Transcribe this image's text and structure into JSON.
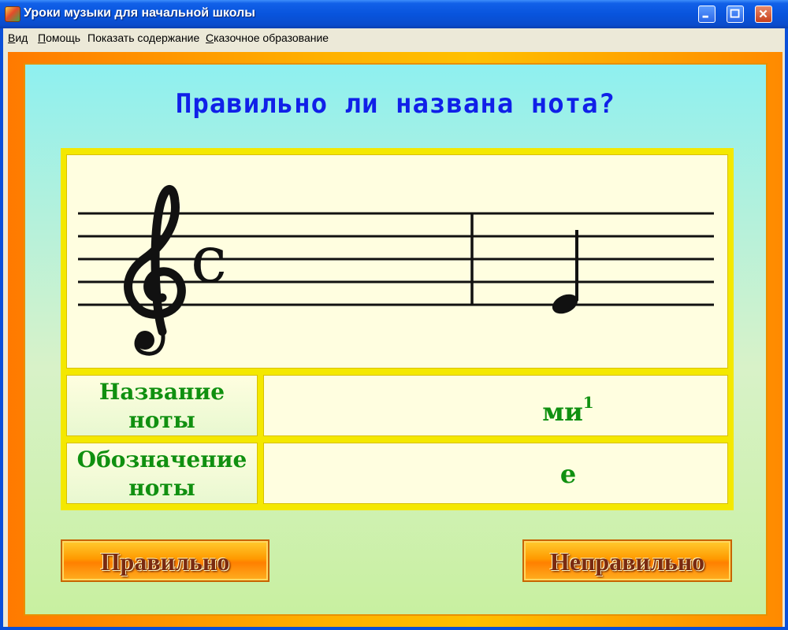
{
  "window": {
    "title": "Уроки музыки для начальной школы",
    "colors": {
      "titlebar": "#0854dd",
      "frame_orange": "#ff8a00"
    }
  },
  "menu": {
    "items": [
      {
        "pre": "",
        "u": "В",
        "post": "ид"
      },
      {
        "pre": "",
        "u": "П",
        "post": "омощь"
      },
      {
        "pre": "Показать со",
        "u": "д",
        "post": "ержание"
      },
      {
        "pre": "",
        "u": "С",
        "post": "казочное образование"
      }
    ]
  },
  "quiz": {
    "question": "Правильно ли названа нота?",
    "clef": "treble-clef-icon",
    "time_signature": "c",
    "rows": {
      "name_label": "Название\nноты",
      "name_value": "ми",
      "name_octave": "1",
      "symbol_label": "Обозначение\nноты",
      "symbol_value": "e"
    },
    "buttons": {
      "correct": "Правильно",
      "wrong": "Неправильно"
    },
    "colors": {
      "question": "#1020e8",
      "cell_text": "#109010",
      "panel": "#f4e800"
    }
  }
}
